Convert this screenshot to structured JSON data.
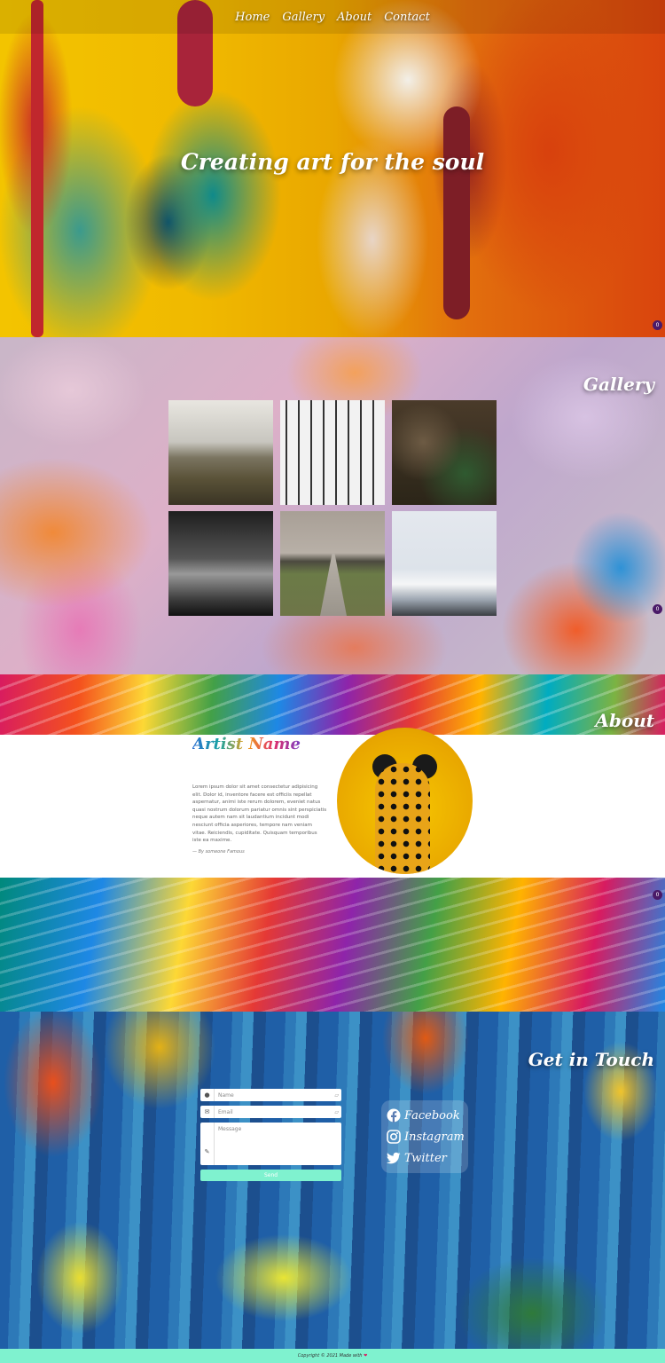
{
  "nav": {
    "items": [
      "Home",
      "Gallery",
      "About",
      "Contact"
    ]
  },
  "hero": {
    "title": "Creating art for the soul"
  },
  "gallery": {
    "heading": "Gallery",
    "images": [
      "landscape-hills",
      "sketch-tools",
      "forest-floor",
      "tree-tunnel",
      "tree-road",
      "snow-mountains"
    ]
  },
  "about": {
    "heading": "About",
    "artist_name": "Artist Name",
    "bio": "Lorem ipsum dolor sit amet consectetur adipisicing elit. Dolor id, inventore facere est officiis repellat aspernatur, animi iste rerum dolorem, eveniet natus quasi nostrum dolorum pariatur omnis sint perspiciatis neque autem nam sit laudantium incidunt modi nesciunt officia asperiores, tempore nam veniam vitae. Reiciendis, cupiditate. Quisquam temporibus iste ea maxime.",
    "quote": "— By someone Famous"
  },
  "contact": {
    "heading": "Get in Touch",
    "name_placeholder": "Name",
    "email_placeholder": "Email",
    "message_placeholder": "Message",
    "send_label": "Send",
    "social": [
      "Facebook",
      "Instagram",
      "Twitter"
    ]
  },
  "footer": {
    "text": "Copyright © 2021 Made with"
  },
  "indicators": [
    "0",
    "0",
    "0"
  ],
  "colors": {
    "accent": "#7ff2cf",
    "indicator": "#4a1a68"
  }
}
